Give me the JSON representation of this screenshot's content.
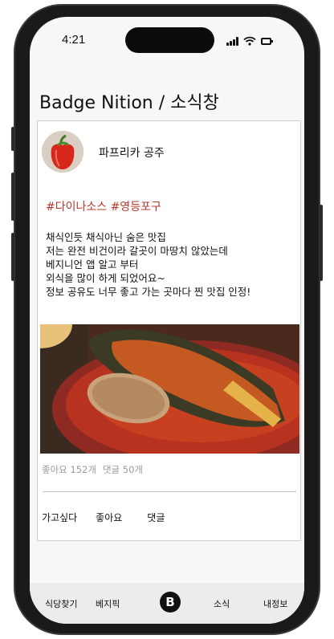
{
  "status_bar": {
    "time": "4:21"
  },
  "page": {
    "title": "Badge Nition / 소식창"
  },
  "post": {
    "username": "파프리카 공주",
    "avatar_icon": "red-bell-pepper-photo",
    "tags": "#다이나소스 #영등포구",
    "body": "채식인듯 채식아닌 숨은 맛집\n저는 완전 비건이라 갈곳이 마땅치 않았는데\n베지니언 앱 알고 부터\n외식을 많이 하게 되었어요~\n정보 공유도 너무 좋고 가는 곳마다 찐 맛집 인정!",
    "photo_icon": "stuffed-eggplant-with-rice-and-tomato-sauce-photo",
    "likes": "좋아요 152개",
    "comments": "댓글 50개",
    "actions": {
      "want_to_go": "가고싶다",
      "like": "좋아요",
      "comment": "댓글"
    }
  },
  "tab_bar": {
    "items": [
      {
        "label": "식당찾기"
      },
      {
        "label": "베지픽"
      },
      {
        "label": "B"
      },
      {
        "label": "소식"
      },
      {
        "label": "내정보"
      }
    ]
  },
  "colors": {
    "tag": "#b5382f",
    "muted": "#9a9a9a",
    "tabbar": "#ececec"
  }
}
